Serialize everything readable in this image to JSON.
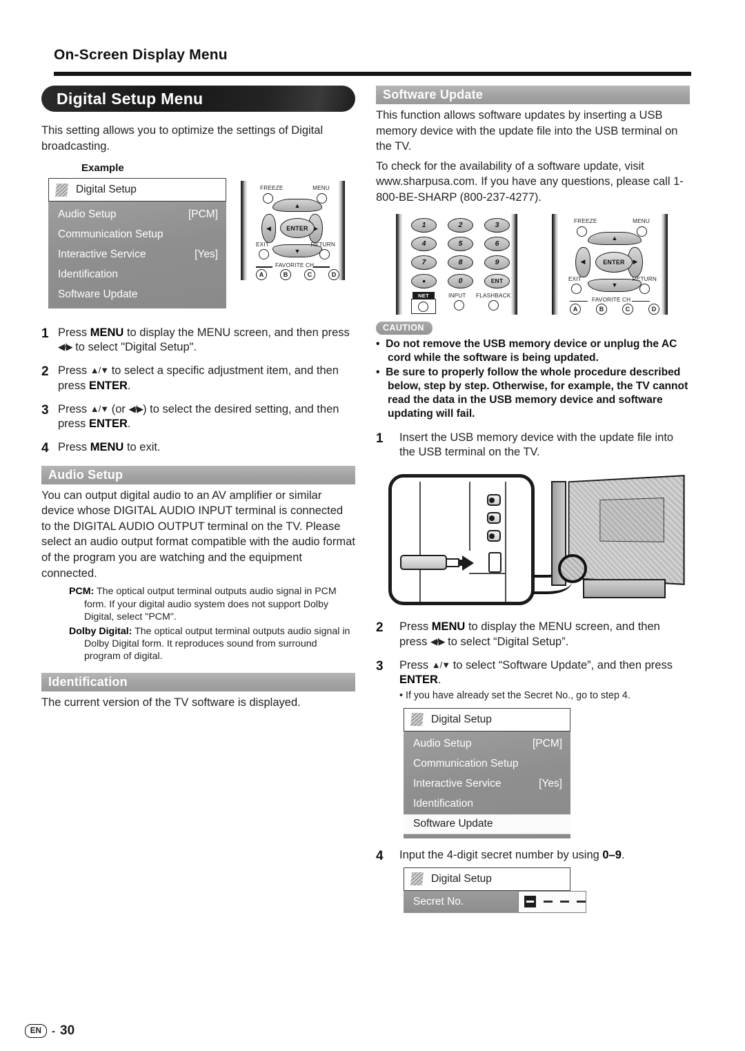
{
  "header": {
    "title": "On-Screen Display Menu"
  },
  "left": {
    "banner": "Digital Setup Menu",
    "intro": "This setting allows you to optimize the settings of Digital broadcasting.",
    "example_label": "Example",
    "osd": {
      "title": "Digital Setup",
      "rows": [
        {
          "label": "Audio Setup",
          "value": "[PCM]",
          "selected": false
        },
        {
          "label": "Communication Setup",
          "value": "",
          "selected": false
        },
        {
          "label": "Interactive Service",
          "value": "[Yes]",
          "selected": false
        },
        {
          "label": "Identification",
          "value": "",
          "selected": false
        },
        {
          "label": "Software Update",
          "value": "",
          "selected": false
        }
      ]
    },
    "steps": [
      {
        "num": "1",
        "html": "Press <b>MENU</b> to display the MENU screen, and then press <span class=\"arrow\">◀/▶</span> to select \"Digital Setup\"."
      },
      {
        "num": "2",
        "html": "Press <span class=\"arrow\">▲/▼</span> to select a specific adjustment item, and then press <b>ENTER</b>."
      },
      {
        "num": "3",
        "html": "Press <span class=\"arrow\">▲/▼</span> (or <span class=\"arrow\">◀/▶</span>) to select the desired setting, and then press <b>ENTER</b>."
      },
      {
        "num": "4",
        "html": "Press <b>MENU</b> to exit."
      }
    ],
    "audio_setup": {
      "heading": "Audio Setup",
      "body": "You can output digital audio to an AV amplifier or similar device whose DIGITAL AUDIO INPUT terminal is connected to the DIGITAL AUDIO OUTPUT terminal on the TV. Please select an audio output format compatible with the audio format of the program you are watching and the equipment connected.",
      "definitions": [
        {
          "term": "PCM:",
          "text": "The optical output terminal outputs audio signal in PCM form. If your digital audio system does not support Dolby Digital, select \"PCM\"."
        },
        {
          "term": "Dolby Digital:",
          "text": "The optical output terminal outputs audio signal in Dolby Digital form. It reproduces sound from surround program of digital."
        }
      ]
    },
    "identification": {
      "heading": "Identification",
      "body": "The current version of the TV software is displayed."
    }
  },
  "right": {
    "heading": "Software Update",
    "intro1": "This function allows software updates by inserting a USB memory device with the update file into the USB terminal on the TV.",
    "intro2": "To check for the availability of a software update, visit www.sharpusa.com. If you have any questions, please call 1-800-BE-SHARP (800-237-4277).",
    "caution": {
      "tag": "CAUTION",
      "items": [
        "Do not remove the USB memory device or unplug the AC cord while the software is being updated.",
        "Be sure to properly follow the whole procedure described below, step by step. Otherwise, for example, the TV cannot read the data in the USB memory device and software updating will fail."
      ]
    },
    "steps": [
      {
        "num": "1",
        "html": "Insert the USB memory device with the update file into the USB terminal on the TV."
      },
      {
        "num": "2",
        "html": "Press <b>MENU</b> to display the MENU screen, and then press <span class=\"arrow\">◀/▶</span> to select “Digital Setup”."
      },
      {
        "num": "3",
        "html": "Press <span class=\"arrow\">▲/▼</span> to select “Software Update”, and then press <b>ENTER</b>."
      },
      {
        "num": "4",
        "html": "Input the 4-digit secret number by using <b>0–9</b>."
      }
    ],
    "step3_note": "If you have already set the Secret No., go to step 4.",
    "osd": {
      "title": "Digital Setup",
      "rows": [
        {
          "label": "Audio Setup",
          "value": "[PCM]",
          "selected": false
        },
        {
          "label": "Communication Setup",
          "value": "",
          "selected": false
        },
        {
          "label": "Interactive Service",
          "value": "[Yes]",
          "selected": false
        },
        {
          "label": "Identification",
          "value": "",
          "selected": false
        },
        {
          "label": "Software Update",
          "value": "",
          "selected": true
        }
      ]
    },
    "secret": {
      "title": "Digital Setup",
      "label": "Secret No.",
      "digits": [
        "",
        "",
        "",
        ""
      ]
    }
  },
  "remotes": {
    "dpad": {
      "freeze": "FREEZE",
      "menu": "MENU",
      "enter": "ENTER",
      "exit": "EXIT",
      "return": "RETURN",
      "favorite": "FAVORITE CH",
      "fav_buttons": [
        "A",
        "B",
        "C",
        "D"
      ]
    },
    "keypad": {
      "keys": [
        "1",
        "2",
        "3",
        "4",
        "5",
        "6",
        "7",
        "8",
        "9",
        "•",
        "0",
        "ENT"
      ],
      "net": "NET",
      "input": "INPUT",
      "flashback": "FLASHBACK"
    }
  },
  "footer": {
    "lang": "EN",
    "separator": "-",
    "page": "30"
  }
}
